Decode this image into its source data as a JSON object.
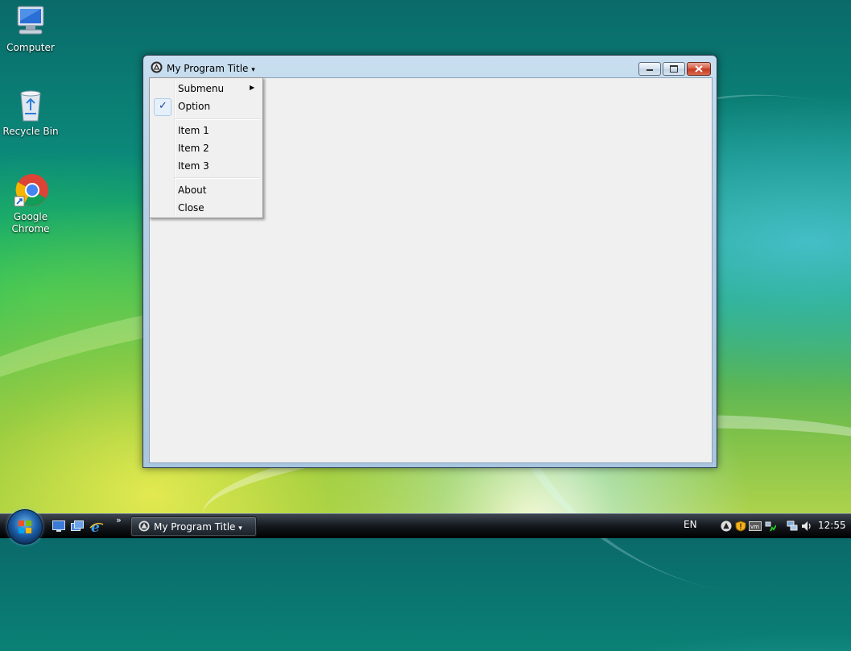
{
  "desktop": {
    "icons": [
      {
        "label": "Computer",
        "icon": "computer-icon"
      },
      {
        "label": "Recycle Bin",
        "icon": "recycle-bin-icon"
      },
      {
        "label": "Google Chrome",
        "icon": "chrome-icon"
      }
    ]
  },
  "window": {
    "title": "My Program Title",
    "title_arrow": "▾",
    "controls": {
      "minimize": "minimize-icon",
      "maximize": "maximize-icon",
      "close": "close-icon"
    }
  },
  "menu": {
    "items": [
      {
        "label": "Submenu",
        "submenu_arrow": "▶"
      },
      {
        "label": "Option",
        "check": "✓"
      },
      {
        "label": "Item 1"
      },
      {
        "label": "Item 2"
      },
      {
        "label": "Item 3"
      },
      {
        "label": "About"
      },
      {
        "label": "Close"
      }
    ]
  },
  "taskbar": {
    "task_label": "My Program Title",
    "task_arrow": "▾",
    "more_glyph": "»",
    "language": "EN",
    "clock": "12:55"
  },
  "colors": {
    "accent": "#1c5fa8",
    "check": "#1c3f9c",
    "close_button": "#c43a20"
  }
}
